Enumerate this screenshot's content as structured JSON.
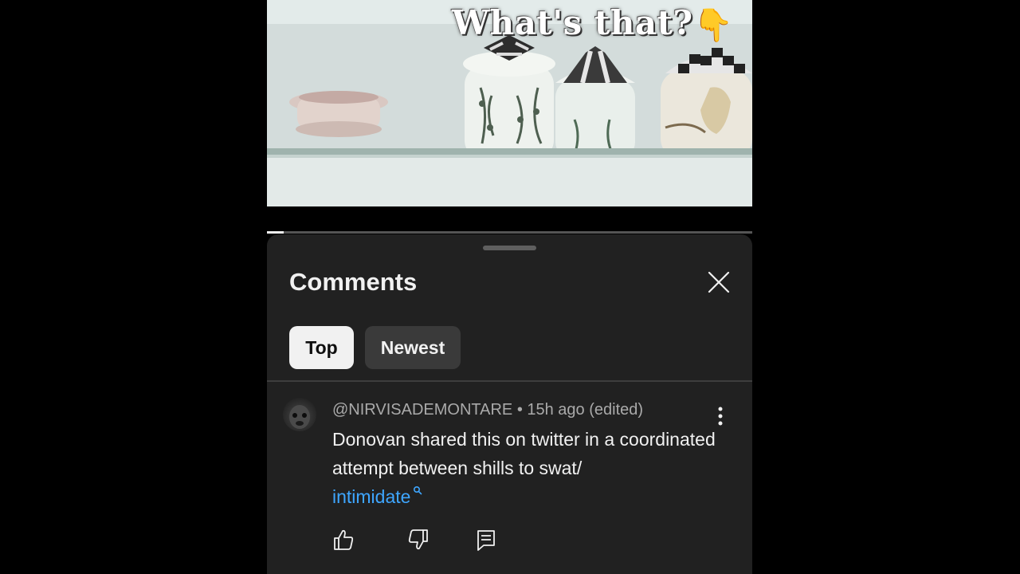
{
  "video": {
    "overlay_text": "What's that?",
    "overlay_emoji": "👇",
    "progress_percent": 3.5
  },
  "comments_panel": {
    "title": "Comments",
    "close_icon": "close-icon",
    "tabs": [
      {
        "label": "Top",
        "selected": true
      },
      {
        "label": "Newest",
        "selected": false
      }
    ]
  },
  "comment": {
    "meta": "@NIRVISADEMONTARE • 15h ago (edited)",
    "text": "Donovan shared this on twitter in a coordinated attempt between shills to swat/",
    "link_text": "intimidate",
    "actions": [
      "like-icon",
      "dislike-icon",
      "reply-icon"
    ]
  },
  "colors": {
    "sheet_bg": "#212121",
    "link": "#3ea6ff",
    "chip_selected": "#f1f1f1",
    "chip_unselected": "#3a3a3a"
  }
}
